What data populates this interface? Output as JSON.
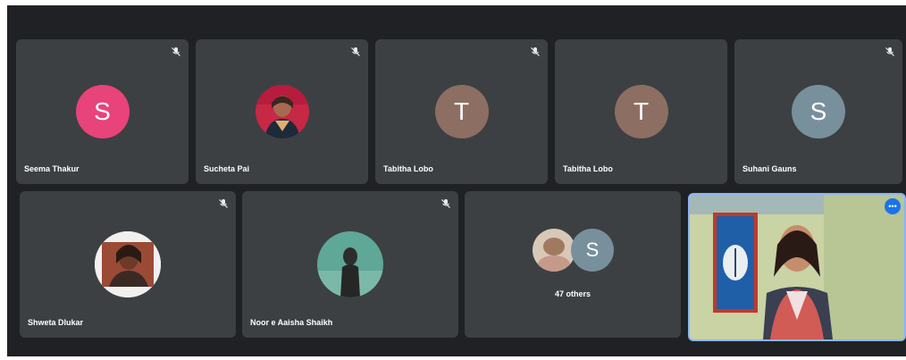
{
  "participants": [
    {
      "name": "Seema Thakur",
      "initial": "S",
      "avatar_color": "#e8437a"
    },
    {
      "name": "Sucheta Pai"
    },
    {
      "name": "Tabitha Lobo",
      "initial": "T",
      "avatar_color": "#8d6e63"
    },
    {
      "name": "Tabitha Lobo",
      "initial": "T",
      "avatar_color": "#8d6e63"
    },
    {
      "name": "Suhani Gauns",
      "initial": "S",
      "avatar_color": "#78909c"
    },
    {
      "name": "Shweta Dlukar"
    },
    {
      "name": "Noor e Aaisha Shaikh"
    }
  ],
  "others": {
    "label": "47 others",
    "initial": "S",
    "avatar_color": "#78909c"
  },
  "self_view": {
    "more_label": "•••"
  },
  "icons": {
    "mic_muted": "mic-off-icon",
    "more": "more-options-icon"
  },
  "colors": {
    "background": "#202124",
    "tile": "#3c4043",
    "active_border": "#8ab4f8"
  }
}
